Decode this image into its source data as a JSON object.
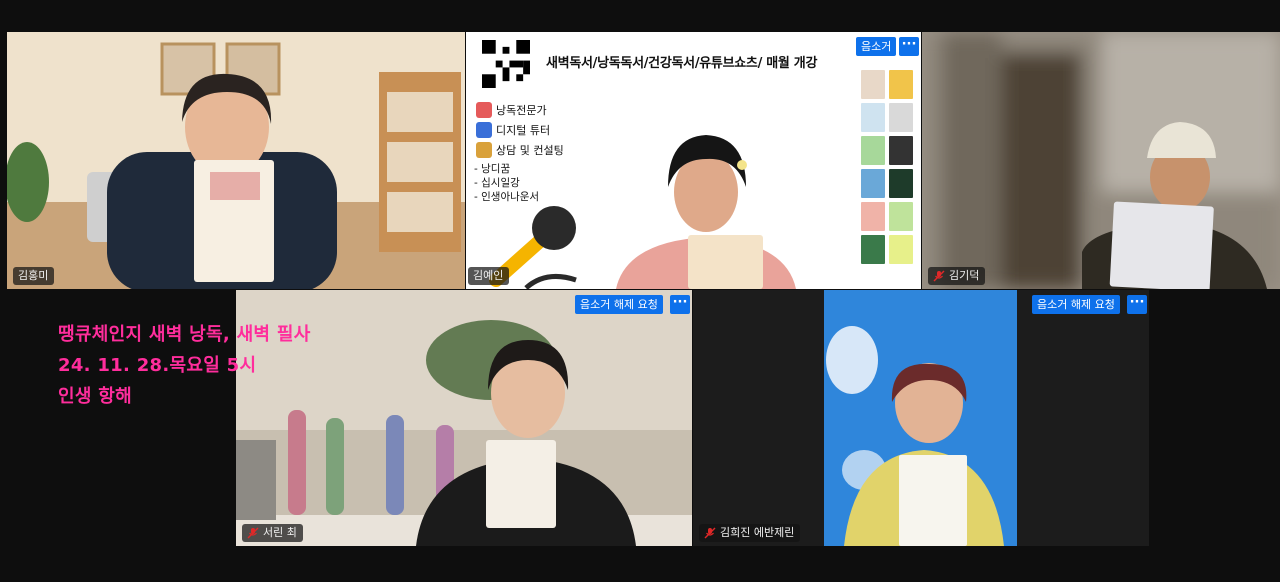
{
  "participants": [
    {
      "name": "김홍미",
      "muted": false,
      "active_speaker": true
    },
    {
      "name": "김예인",
      "muted": false,
      "sharing_slide": true
    },
    {
      "name": "김기덕",
      "muted": true
    },
    {
      "name": "서린 최",
      "muted": true
    },
    {
      "name": "김희진 에반제린",
      "muted": true
    }
  ],
  "tile_controls": {
    "mute_label": "음소거",
    "unmute_request_label": "음소거 해제 요청",
    "more_label": "···"
  },
  "slide": {
    "title": "새벽독서/낭독독서/건강독서/유튜브쇼츠/ 매월 개강",
    "items": [
      "낭독전문가",
      "디지털 튜터",
      "상담 및 컨설팅"
    ],
    "sub_items": [
      "- 낭디꿈",
      "- 십시일강",
      "- 인생아나운서"
    ]
  },
  "overlay": {
    "line1": "땡큐체인지 새벽 낭독, 새벽 필사",
    "line2": "24. 11. 28.목요일 5시",
    "line3": "인생 항해"
  },
  "colors": {
    "accent_blue": "#0e71eb",
    "active_border": "#3ed36a",
    "overlay_pink": "#ff2d9c",
    "mute_red": "#e02828"
  }
}
